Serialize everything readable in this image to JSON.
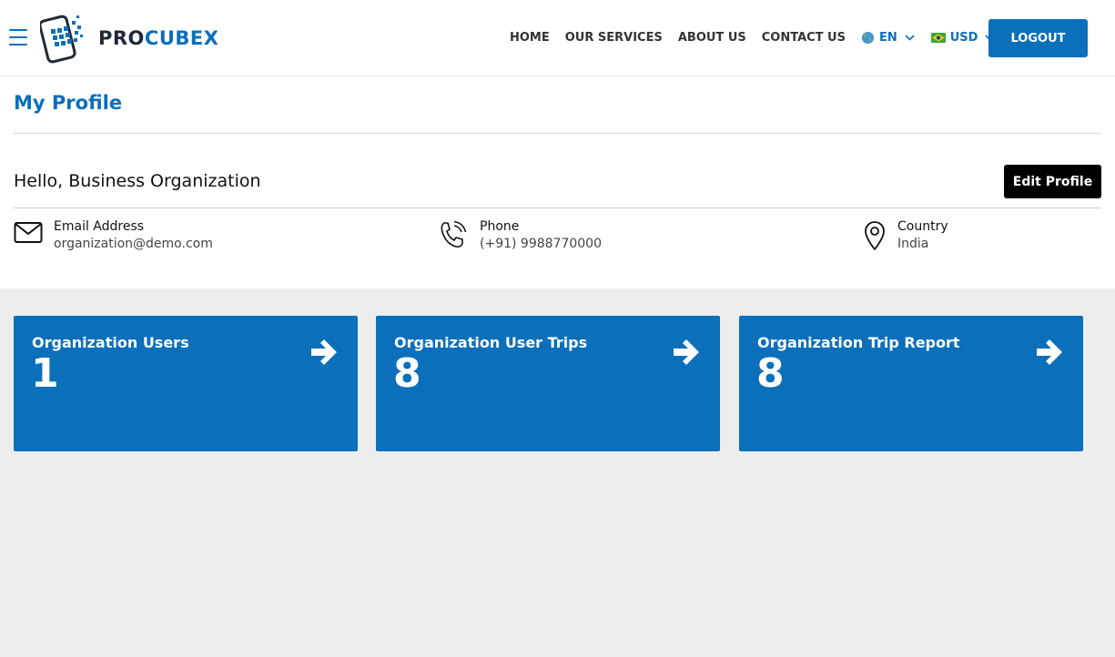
{
  "header": {
    "logo": {
      "pro": "PRO",
      "cubex": "CUBEX"
    },
    "nav": [
      {
        "label": "HOME"
      },
      {
        "label": "OUR SERVICES"
      },
      {
        "label": "ABOUT US"
      },
      {
        "label": "CONTACT US"
      }
    ],
    "language": {
      "label": "EN",
      "icon": "globe-icon"
    },
    "currency": {
      "label": "USD",
      "icon": "currency-flag-icon"
    },
    "logout_label": "LOGOUT"
  },
  "profile": {
    "title": "My Profile",
    "greeting": "Hello, Business Organization",
    "edit_label": "Edit Profile",
    "email": {
      "label": "Email Address",
      "value": "organization@demo.com",
      "icon": "mail-icon"
    },
    "phone": {
      "label": "Phone",
      "value": "(+91) 9988770000",
      "icon": "phone-icon"
    },
    "country": {
      "label": "Country",
      "value": "India",
      "icon": "location-pin-icon"
    }
  },
  "cards": [
    {
      "title": "Organization Users",
      "count": "1",
      "icon": "arrow-right-icon"
    },
    {
      "title": "Organization User Trips",
      "count": "8",
      "icon": "arrow-right-icon"
    },
    {
      "title": "Organization Trip Report",
      "count": "8",
      "icon": "arrow-right-icon"
    }
  ],
  "colors": {
    "brand": "#0b6fba",
    "dark": "#1f2a36",
    "background": "#ededed"
  }
}
